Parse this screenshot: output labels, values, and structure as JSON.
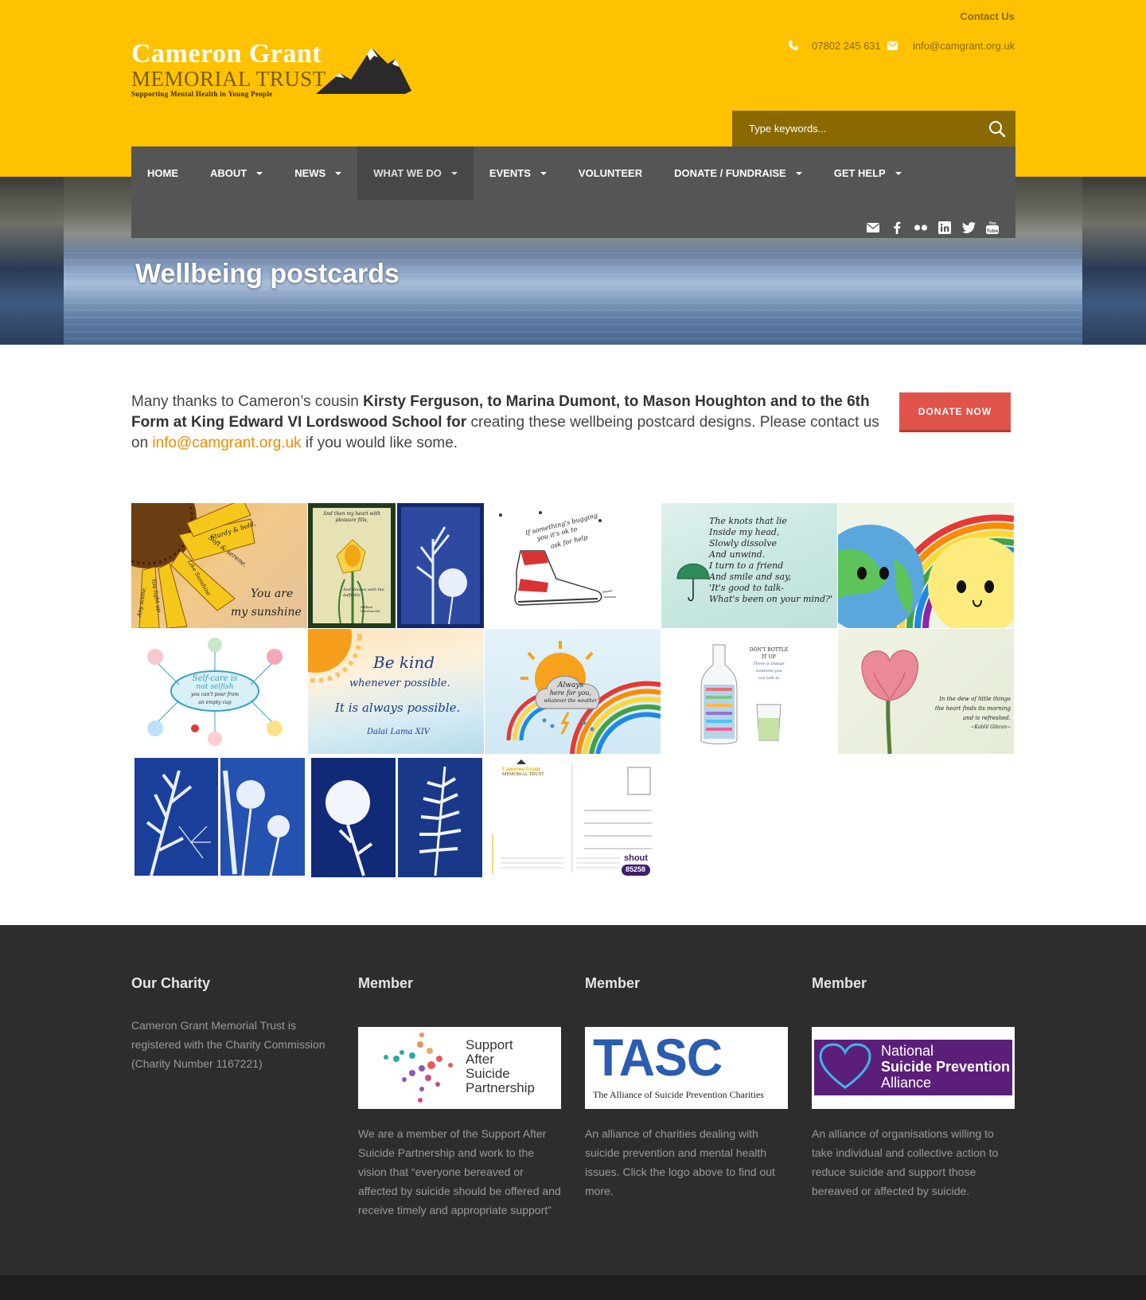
{
  "header": {
    "contact_link": "Contact Us",
    "phone": "07802 245 631",
    "email": "info@camgrant.org.uk",
    "logo": {
      "line1": "Cameron Grant",
      "line2": "MEMORIAL TRUST",
      "line3": "Supporting Mental Health in Young People"
    },
    "search_placeholder": "Type keywords..."
  },
  "nav": {
    "items": [
      {
        "label": "HOME",
        "dropdown": false
      },
      {
        "label": "ABOUT",
        "dropdown": true
      },
      {
        "label": "NEWS",
        "dropdown": true
      },
      {
        "label": "WHAT WE DO",
        "dropdown": true,
        "active": true
      },
      {
        "label": "EVENTS",
        "dropdown": true
      },
      {
        "label": "VOLUNTEER",
        "dropdown": false
      },
      {
        "label": "DONATE / FUNDRAISE",
        "dropdown": true
      },
      {
        "label": "GET HELP",
        "dropdown": true
      }
    ],
    "social": [
      "mail-icon",
      "facebook-icon",
      "flickr-icon",
      "linkedin-icon",
      "twitter-icon",
      "youtube-icon"
    ]
  },
  "banner": {
    "title": "Wellbeing postcards"
  },
  "intro": {
    "part1": "Many thanks to Cameron’s cousin ",
    "bold": "Kirsty Ferguson, to Marina Dumont, to Mason Houghton and to the 6th Form at King Edward VI Lordswood School for",
    "part2": " creating these wellbeing postcard designs. Please contact us on ",
    "email": "info@camgrant.org.uk",
    "part3": " if you would like some."
  },
  "donate_button": "DONATE NOW",
  "postcards": {
    "sunflower": {
      "lines": [
        "Sturdy & bold,",
        "Soft & serene.",
        "Like Sunshine",
        "in the form,",
        "You light up",
        "Any scene."
      ],
      "big": [
        "You are",
        "my sunshine"
      ]
    },
    "daffodil": {
      "top": "And then my heart with pleasure fills,",
      "bottom": "And dances with the daffodils",
      "credit": "William Wordsworth"
    },
    "shoe": {
      "text": [
        "If something's bugging",
        "you it's ok to",
        "ask for help"
      ]
    },
    "knots": {
      "lines": [
        "The knots that lie",
        "Inside my head,",
        "Slowly dissolve",
        "And unwind.",
        "I turn to a friend",
        "And smile and say,",
        "'It's good to talk-",
        "What's been on your mind?'"
      ]
    },
    "selfcare": {
      "center": [
        "Self-care is",
        "not selfish",
        "you can't pour from",
        "an empty cup"
      ]
    },
    "bekind": {
      "lines": [
        "Be kind",
        "whenever possible.",
        "It is always possible."
      ],
      "credit": "Dalai Lama XIV"
    },
    "weather": {
      "lines": [
        "Always",
        "here for you,",
        "whatever the weather"
      ]
    },
    "bottle": {
      "lines": [
        "DON'T BOTTLE",
        "IT UP"
      ],
      "sub": [
        "There is always",
        "someone you",
        "can talk to"
      ]
    },
    "poppy": {
      "lines": [
        "In the dew of little things",
        "the heart finds its morning",
        "and is refreshed."
      ],
      "credit": "~Kahlil Gibran~"
    },
    "back": {
      "logo1": "Cameron Grant",
      "logo2": "MEMORIAL TRUST",
      "shout": "shout",
      "shout_num": "85258"
    }
  },
  "footer": {
    "charity": {
      "title": "Our Charity",
      "text": "Cameron Grant Memorial Trust is registered with the Charity Commission (Charity Number 1167221)"
    },
    "members": [
      {
        "title": "Member",
        "logo_lines": [
          "Support",
          "After",
          "Suicide",
          "Partnership"
        ],
        "text": "We are a member of the Support After Suicide Partnership and work to the vision that “everyone bereaved or affected by suicide should be offered and receive timely and appropriate support”"
      },
      {
        "title": "Member",
        "logo_big": "TASC",
        "logo_sub": "The Alliance of Suicide Prevention Charities",
        "text": "An alliance of charities dealing with suicide prevention and mental health issues. Click the logo above to find out more."
      },
      {
        "title": "Member",
        "logo_lines": [
          "National",
          "Suicide Prevention",
          "Alliance"
        ],
        "text": "An alliance of organisations willing to take individual and collective action to reduce suicide and support those bereaved or affected by suicide."
      }
    ]
  },
  "colors": {
    "header_bg": "#ffc200",
    "search_bg": "#8a6a00",
    "nav_bg": "#555555",
    "donate_bg": "#e0534a",
    "footer_bg": "#2d2d2d",
    "link": "#f08a00"
  }
}
